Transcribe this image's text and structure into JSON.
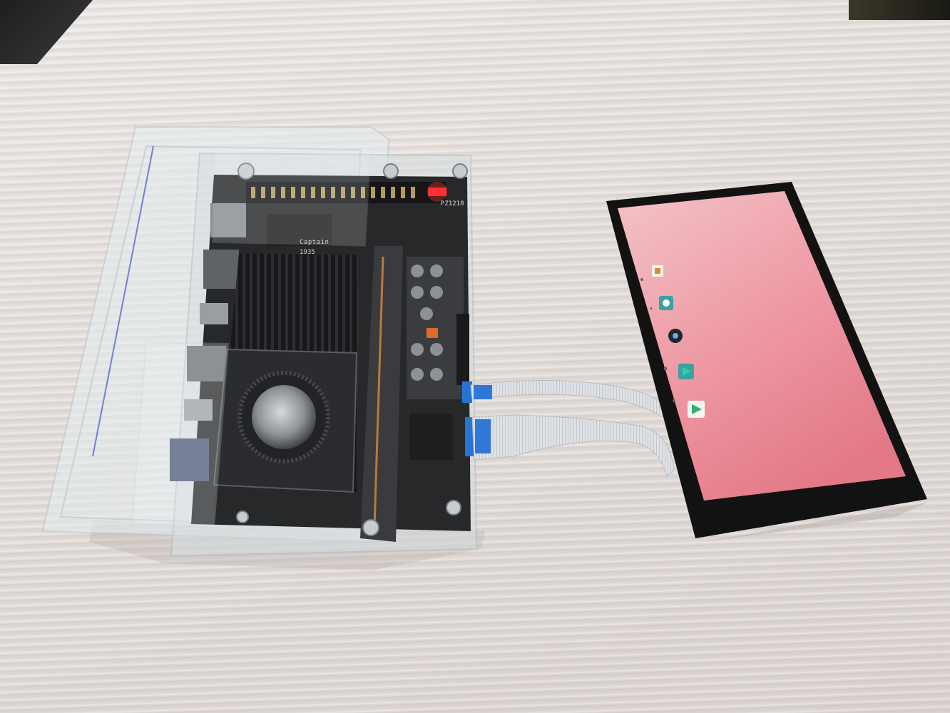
{
  "photo": {
    "board_markings": {
      "silkscreen_1": "Captain",
      "silkscreen_2": "1935",
      "silkscreen_3": "PZ1218"
    },
    "screen_icons": [
      "gallery-icon",
      "settings-icon",
      "camera-icon",
      "play-store-icon",
      "play-store-icon"
    ],
    "colors": {
      "table": "#e6e1de",
      "acrylic": "#dfe6ea",
      "board": "#2a2b2d",
      "heatsink": "#1b1b1d",
      "display_bezel": "#121212",
      "display_screen_top": "#f0b7be",
      "display_screen_bottom": "#e57887",
      "led": "#ff2a2a",
      "cable": "#d9dcdf",
      "cable_tab": "#2f78d8"
    }
  }
}
